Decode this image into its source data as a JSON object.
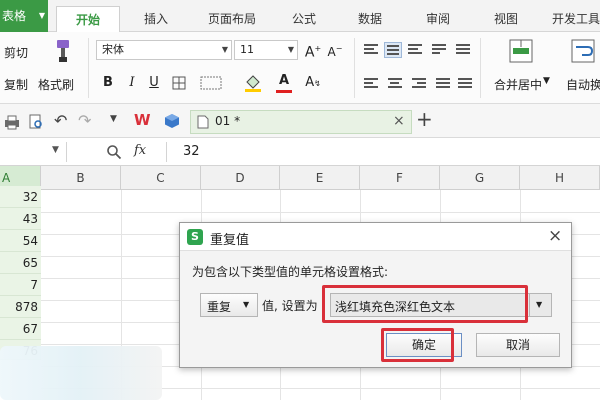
{
  "tabbar": {
    "app_label": "表格",
    "tabs": [
      "开始",
      "插入",
      "页面布局",
      "公式",
      "数据",
      "审阅",
      "视图",
      "开发工具"
    ]
  },
  "ribbon": {
    "cut": "剪切",
    "copy": "复制",
    "format_painter": "格式刷",
    "font_name": "宋体",
    "font_size": "11",
    "bold": "B",
    "italic": "I",
    "underline": "U",
    "font_color_glyph": "A",
    "grow_font": "A",
    "shrink_font": "A",
    "merge_center": "合并居中",
    "auto_wrap": "自动换"
  },
  "quickbar": {
    "doc_tab": "01 *",
    "close": "×",
    "new_tab": "+"
  },
  "formula_bar": {
    "fx": "fx",
    "value": "32"
  },
  "grid": {
    "active_col": "A",
    "columns": [
      "B",
      "C",
      "D",
      "E",
      "F",
      "G",
      "H"
    ],
    "values": [
      "32",
      "43",
      "54",
      "65",
      "7",
      "878",
      "67",
      "76"
    ]
  },
  "dialog": {
    "title": "重复值",
    "prompt": "为包含以下类型值的单元格设置格式:",
    "type_option": "重复",
    "value_label": "值, 设置为",
    "format_option": "浅红填充色深红色文本",
    "ok": "确定",
    "cancel": "取消"
  },
  "colors": {
    "accent": "#3b9a45",
    "highlight": "#d9303a"
  }
}
